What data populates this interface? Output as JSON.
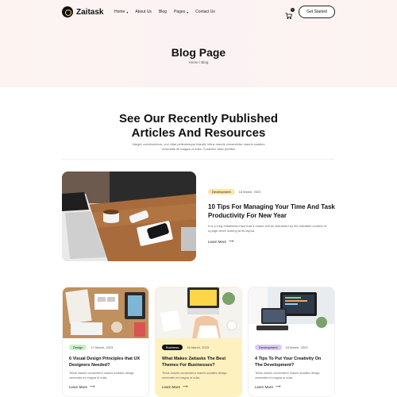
{
  "brand": {
    "name": "Zaitask"
  },
  "nav": {
    "items": [
      {
        "label": "Home",
        "dropdown": true
      },
      {
        "label": "About Us",
        "dropdown": false
      },
      {
        "label": "Blog",
        "dropdown": false
      },
      {
        "label": "Pages",
        "dropdown": true
      },
      {
        "label": "Contact Us",
        "dropdown": false
      }
    ],
    "cart_count": "0",
    "cta_label": "Get Started"
  },
  "hero": {
    "title": "Blog Page",
    "breadcrumb": "Home / Blog"
  },
  "section": {
    "title_line1": "See Our Recently Published",
    "title_line2": "Articles And Resources",
    "subtitle": "Integer condimentum, orci vitae pellentesque blandit, tellus mauris consectetur mauris sodales venenatis mi magna ut nulla. Curabitur vitae porttitor"
  },
  "featured": {
    "tag": "Development",
    "tag_color": "#fbe6a8",
    "date": "18 March, 2023",
    "title": "10 Tips For Managing Your Time And Task Productivity For New Year",
    "excerpt": "It is a long established fact that a reader will be distracted by the readable content of a page when looking at its layout.",
    "read_more": "Learn More"
  },
  "cards": [
    {
      "tag": "Design",
      "tag_color": "#c9f2c6",
      "date": "17 March, 2023",
      "title": "6 Visual Design Principles that UX Designers Needed?",
      "excerpt": "Tellus mauris consectetur mauris sodales design venenatis mi magna ut nulla.",
      "read_more": "Learn More",
      "bg": "#ffffff"
    },
    {
      "tag": "Business",
      "tag_color": "#111111",
      "date": "16 March, 2023",
      "title": "What Makes Zaitasks The Best Themes For Businesses?",
      "excerpt": "Tellus mauris consectetur mauris sodales design venenatis mi magna ut nulla.",
      "read_more": "Learn More",
      "bg": "#fdf1bf"
    },
    {
      "tag": "Development",
      "tag_color": "#dccaf7",
      "date": "15 March, 2023",
      "title": "4 Tips To Put Your Creativity On The Development?",
      "excerpt": "Tellus mauris consectetur mauris sodales design venenatis mi magna ut nulla.",
      "read_more": "Learn More",
      "bg": "#ffffff"
    }
  ]
}
